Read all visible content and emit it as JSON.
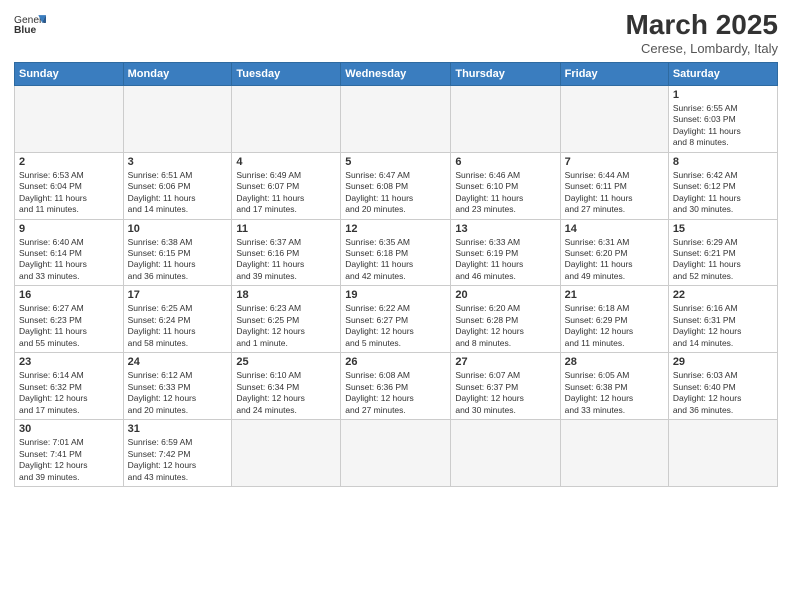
{
  "header": {
    "logo_text_normal": "General",
    "logo_text_bold": "Blue",
    "month_year": "March 2025",
    "subtitle": "Cerese, Lombardy, Italy"
  },
  "weekdays": [
    "Sunday",
    "Monday",
    "Tuesday",
    "Wednesday",
    "Thursday",
    "Friday",
    "Saturday"
  ],
  "weeks": [
    [
      {
        "day": "",
        "info": ""
      },
      {
        "day": "",
        "info": ""
      },
      {
        "day": "",
        "info": ""
      },
      {
        "day": "",
        "info": ""
      },
      {
        "day": "",
        "info": ""
      },
      {
        "day": "",
        "info": ""
      },
      {
        "day": "1",
        "info": "Sunrise: 6:55 AM\nSunset: 6:03 PM\nDaylight: 11 hours\nand 8 minutes."
      }
    ],
    [
      {
        "day": "2",
        "info": "Sunrise: 6:53 AM\nSunset: 6:04 PM\nDaylight: 11 hours\nand 11 minutes."
      },
      {
        "day": "3",
        "info": "Sunrise: 6:51 AM\nSunset: 6:06 PM\nDaylight: 11 hours\nand 14 minutes."
      },
      {
        "day": "4",
        "info": "Sunrise: 6:49 AM\nSunset: 6:07 PM\nDaylight: 11 hours\nand 17 minutes."
      },
      {
        "day": "5",
        "info": "Sunrise: 6:47 AM\nSunset: 6:08 PM\nDaylight: 11 hours\nand 20 minutes."
      },
      {
        "day": "6",
        "info": "Sunrise: 6:46 AM\nSunset: 6:10 PM\nDaylight: 11 hours\nand 23 minutes."
      },
      {
        "day": "7",
        "info": "Sunrise: 6:44 AM\nSunset: 6:11 PM\nDaylight: 11 hours\nand 27 minutes."
      },
      {
        "day": "8",
        "info": "Sunrise: 6:42 AM\nSunset: 6:12 PM\nDaylight: 11 hours\nand 30 minutes."
      }
    ],
    [
      {
        "day": "9",
        "info": "Sunrise: 6:40 AM\nSunset: 6:14 PM\nDaylight: 11 hours\nand 33 minutes."
      },
      {
        "day": "10",
        "info": "Sunrise: 6:38 AM\nSunset: 6:15 PM\nDaylight: 11 hours\nand 36 minutes."
      },
      {
        "day": "11",
        "info": "Sunrise: 6:37 AM\nSunset: 6:16 PM\nDaylight: 11 hours\nand 39 minutes."
      },
      {
        "day": "12",
        "info": "Sunrise: 6:35 AM\nSunset: 6:18 PM\nDaylight: 11 hours\nand 42 minutes."
      },
      {
        "day": "13",
        "info": "Sunrise: 6:33 AM\nSunset: 6:19 PM\nDaylight: 11 hours\nand 46 minutes."
      },
      {
        "day": "14",
        "info": "Sunrise: 6:31 AM\nSunset: 6:20 PM\nDaylight: 11 hours\nand 49 minutes."
      },
      {
        "day": "15",
        "info": "Sunrise: 6:29 AM\nSunset: 6:21 PM\nDaylight: 11 hours\nand 52 minutes."
      }
    ],
    [
      {
        "day": "16",
        "info": "Sunrise: 6:27 AM\nSunset: 6:23 PM\nDaylight: 11 hours\nand 55 minutes."
      },
      {
        "day": "17",
        "info": "Sunrise: 6:25 AM\nSunset: 6:24 PM\nDaylight: 11 hours\nand 58 minutes."
      },
      {
        "day": "18",
        "info": "Sunrise: 6:23 AM\nSunset: 6:25 PM\nDaylight: 12 hours\nand 1 minute."
      },
      {
        "day": "19",
        "info": "Sunrise: 6:22 AM\nSunset: 6:27 PM\nDaylight: 12 hours\nand 5 minutes."
      },
      {
        "day": "20",
        "info": "Sunrise: 6:20 AM\nSunset: 6:28 PM\nDaylight: 12 hours\nand 8 minutes."
      },
      {
        "day": "21",
        "info": "Sunrise: 6:18 AM\nSunset: 6:29 PM\nDaylight: 12 hours\nand 11 minutes."
      },
      {
        "day": "22",
        "info": "Sunrise: 6:16 AM\nSunset: 6:31 PM\nDaylight: 12 hours\nand 14 minutes."
      }
    ],
    [
      {
        "day": "23",
        "info": "Sunrise: 6:14 AM\nSunset: 6:32 PM\nDaylight: 12 hours\nand 17 minutes."
      },
      {
        "day": "24",
        "info": "Sunrise: 6:12 AM\nSunset: 6:33 PM\nDaylight: 12 hours\nand 20 minutes."
      },
      {
        "day": "25",
        "info": "Sunrise: 6:10 AM\nSunset: 6:34 PM\nDaylight: 12 hours\nand 24 minutes."
      },
      {
        "day": "26",
        "info": "Sunrise: 6:08 AM\nSunset: 6:36 PM\nDaylight: 12 hours\nand 27 minutes."
      },
      {
        "day": "27",
        "info": "Sunrise: 6:07 AM\nSunset: 6:37 PM\nDaylight: 12 hours\nand 30 minutes."
      },
      {
        "day": "28",
        "info": "Sunrise: 6:05 AM\nSunset: 6:38 PM\nDaylight: 12 hours\nand 33 minutes."
      },
      {
        "day": "29",
        "info": "Sunrise: 6:03 AM\nSunset: 6:40 PM\nDaylight: 12 hours\nand 36 minutes."
      }
    ],
    [
      {
        "day": "30",
        "info": "Sunrise: 7:01 AM\nSunset: 7:41 PM\nDaylight: 12 hours\nand 39 minutes."
      },
      {
        "day": "31",
        "info": "Sunrise: 6:59 AM\nSunset: 7:42 PM\nDaylight: 12 hours\nand 43 minutes."
      },
      {
        "day": "",
        "info": ""
      },
      {
        "day": "",
        "info": ""
      },
      {
        "day": "",
        "info": ""
      },
      {
        "day": "",
        "info": ""
      },
      {
        "day": "",
        "info": ""
      }
    ]
  ]
}
